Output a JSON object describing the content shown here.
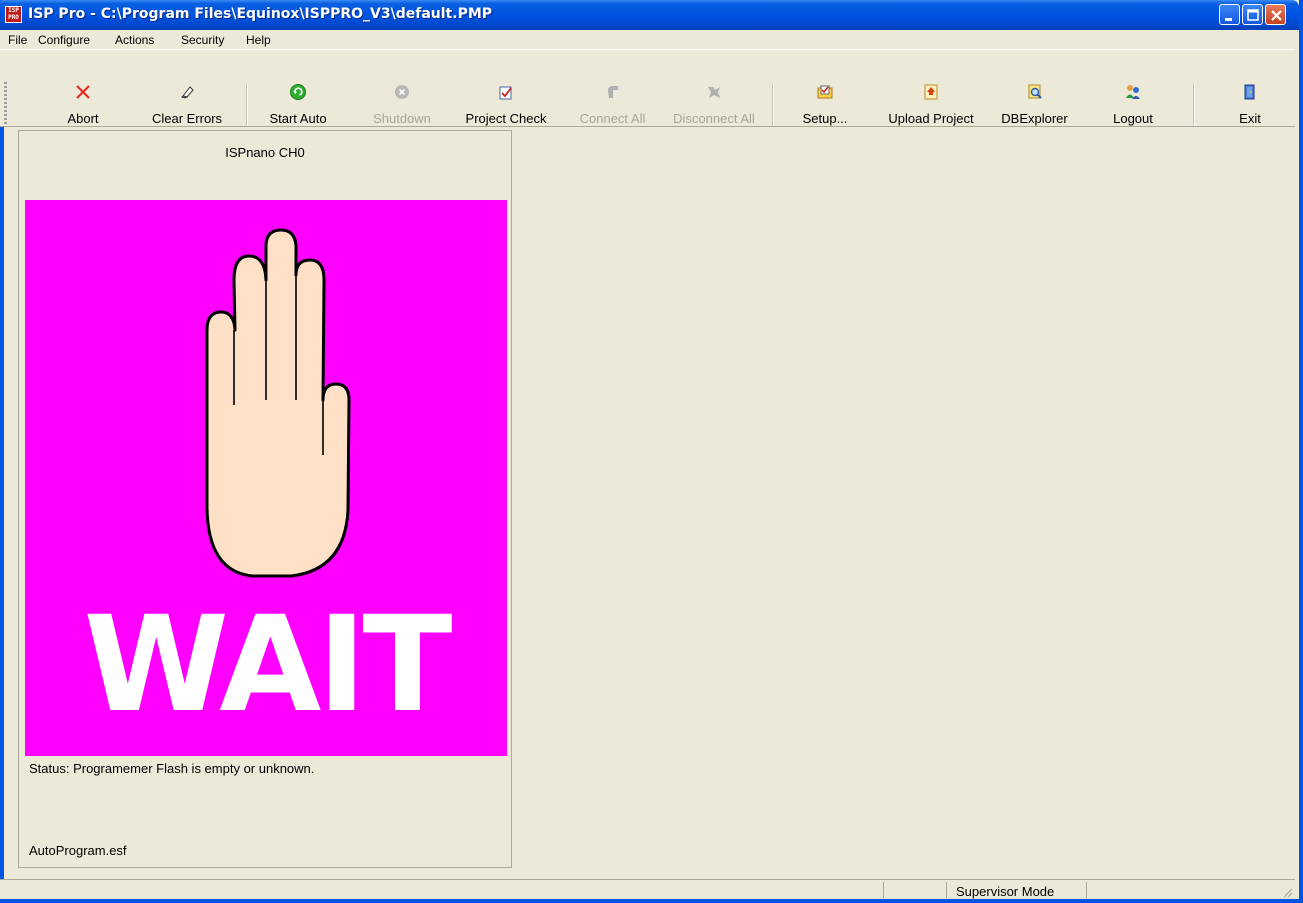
{
  "window": {
    "title": "ISP Pro - C:\\Program Files\\Equinox\\ISPPRO_V3\\default.PMP",
    "app_icon_text": "ISP PRO"
  },
  "menu": [
    {
      "label": "File"
    },
    {
      "label": "Configure"
    },
    {
      "label": "Actions"
    },
    {
      "label": "Security"
    },
    {
      "label": "Help"
    }
  ],
  "toolbar": {
    "abort": "Abort",
    "clear_errors": "Clear Errors",
    "start_auto": "Start Auto",
    "shutdown": "Shutdown",
    "project_check": "Project Check",
    "connect_all": "Connect All",
    "disconnect_all": "Disconnect All",
    "setup": "Setup...",
    "upload_project": "Upload Project",
    "dbexplorer": "DBExplorer",
    "logout": "Logout",
    "exit": "Exit"
  },
  "panel": {
    "title": "ISPnano CH0",
    "wait_text": "WAIT",
    "status": "Status: Programemer Flash is empty or unknown.",
    "file": "AutoProgram.esf"
  },
  "statusbar": {
    "mode": "Supervisor Mode"
  },
  "colors": {
    "wait_background": "#ff00ff",
    "titlebar": "#0054e3",
    "window_bg": "#ece9d8"
  }
}
